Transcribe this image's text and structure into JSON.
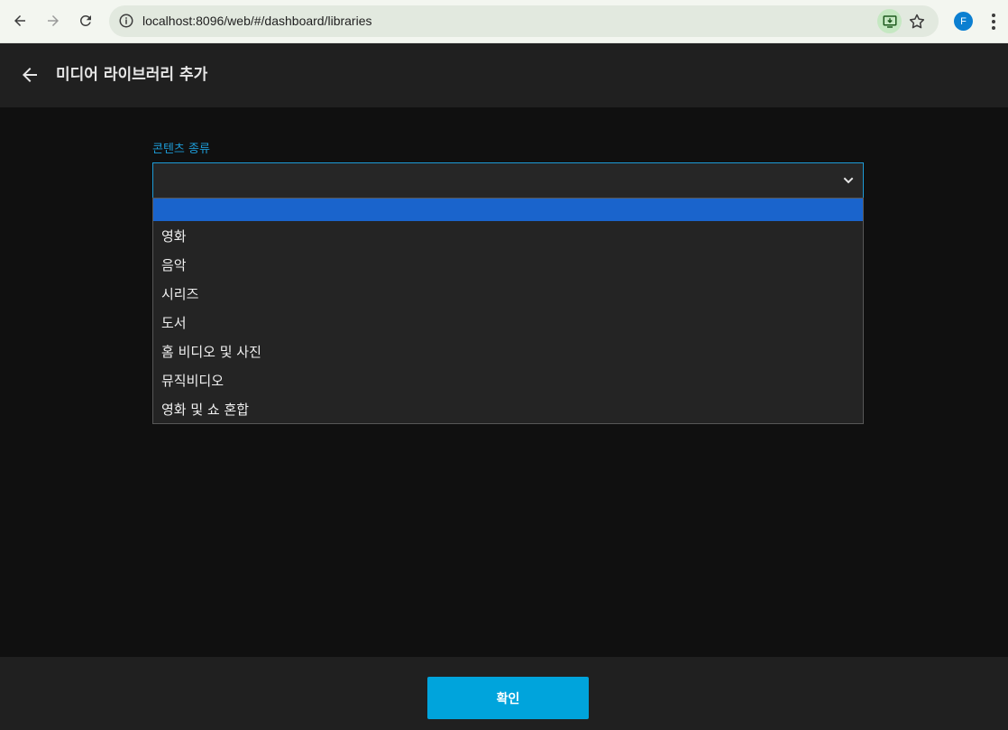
{
  "browser": {
    "url": "localhost:8096/web/#/dashboard/libraries",
    "profile_initial": "F"
  },
  "header": {
    "title": "미디어 라이브러리 추가"
  },
  "form": {
    "content_type_label": "콘텐츠 종류",
    "selected_value": "",
    "options": [
      "",
      "영화",
      "음악",
      "시리즈",
      "도서",
      "홈 비디오 및 사진",
      "뮤직비디오",
      "영화 및 쇼 혼합"
    ]
  },
  "footer": {
    "confirm_label": "확인"
  },
  "colors": {
    "accent": "#00a4dc",
    "selected_option": "#1a64cc",
    "background": "#101010",
    "panel": "#202020"
  }
}
